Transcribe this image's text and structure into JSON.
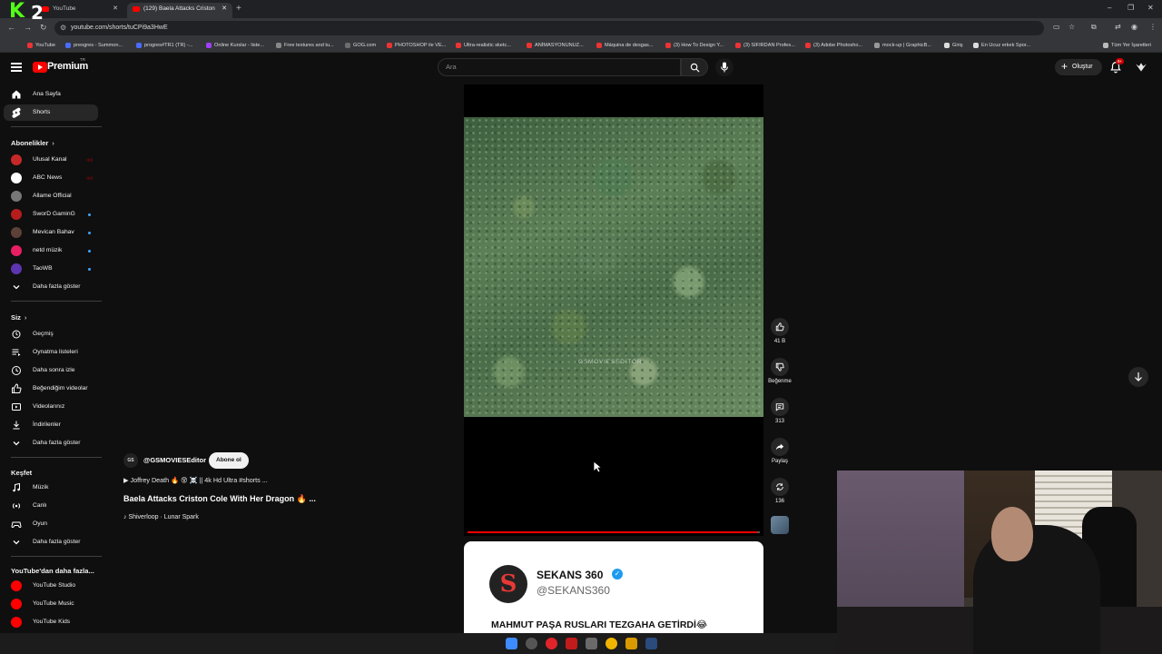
{
  "browser": {
    "tabs": [
      {
        "label": "YouTube"
      },
      {
        "label": "(129) Baela Attacks Criston"
      }
    ],
    "url": "youtube.com/shorts/tuCPi9a3HwE",
    "bookmarks": [
      "YouTube",
      "preogres - Summon...",
      "progres#TR1 (TR) -...",
      "Online Kurslar - liste...",
      "Free textures and tu...",
      "GOG.com",
      "PHOTOSHOP ile VE...",
      "Ultra-realistic sketc...",
      "ANİMASYONUNUZ...",
      "Máquina de desgas...",
      "(3) How To Design Y...",
      "(3) SIFIRDAN Profes...",
      "(3) Adobe Photosho...",
      "mock-up | GraphicB...",
      "Giriş",
      "En Ucuz erkek Spor..."
    ],
    "all_bookmarks": "Tüm Yer İşaretleri",
    "overlay_logo_letters": "K2"
  },
  "masthead": {
    "logo_text": "Premium",
    "region": "TR",
    "search_placeholder": "Ara",
    "create_label": "Oluştur",
    "notif_count": "9+"
  },
  "sidebar": {
    "main": [
      {
        "label": "Ana Sayfa",
        "icon": "home-icon"
      },
      {
        "label": "Shorts",
        "icon": "shorts-icon",
        "active": true
      }
    ],
    "subs_title": "Abonelikler",
    "subs": [
      {
        "label": "Ulusal Kanal",
        "color": "#c62828",
        "live": true
      },
      {
        "label": "ABC News",
        "color": "#ffffff",
        "live": true
      },
      {
        "label": "Allame Official",
        "color": "#777777"
      },
      {
        "label": "SworD GaminG",
        "color": "#b71c1c",
        "dot": true
      },
      {
        "label": "Mevican Bahav",
        "color": "#5d4037",
        "dot": true
      },
      {
        "label": "netd müzik",
        "color": "#e91e63",
        "dot": true
      },
      {
        "label": "TaoWB",
        "color": "#5e35b1",
        "dot": true
      }
    ],
    "subs_more": "Daha fazla göster",
    "you_title": "Siz",
    "you": [
      {
        "label": "Geçmiş",
        "icon": "history-icon"
      },
      {
        "label": "Oynatma listeleri",
        "icon": "playlist-icon"
      },
      {
        "label": "Daha sonra izle",
        "icon": "clock-icon"
      },
      {
        "label": "Beğendiğim videolar",
        "icon": "like-icon"
      },
      {
        "label": "Videolarınız",
        "icon": "video-icon"
      },
      {
        "label": "İndirilenler",
        "icon": "download-icon"
      }
    ],
    "you_more": "Daha fazla göster",
    "explore_title": "Keşfet",
    "explore": [
      {
        "label": "Müzik",
        "icon": "music-icon"
      },
      {
        "label": "Canlı",
        "icon": "live-icon"
      },
      {
        "label": "Oyun",
        "icon": "gaming-icon"
      }
    ],
    "explore_more": "Daha fazla göster",
    "more_title": "YouTube'dan daha fazla...",
    "more": [
      {
        "label": "YouTube Studio"
      },
      {
        "label": "YouTube Music"
      },
      {
        "label": "YouTube Kids"
      }
    ]
  },
  "short": {
    "channel_avatar": "GS",
    "channel": "@GSMOVIESEditor",
    "subscribe_label": "Abone ol",
    "description": "▶ Joffrey Death 🔥 😵 ☠️ || 4k Hd Ultra #shorts ...",
    "title": "Baela Attacks Criston Cole With Her Dragon 🔥 ...",
    "music": "♪ Shiverloop · Lunar Spark",
    "watermark": "GSMOVIESEDITOR",
    "progress": 0.99,
    "likes": "41 B",
    "dislike_label": "Beğenme",
    "comments": "313",
    "share_label": "Paylaş",
    "remix": "136"
  },
  "next_short": {
    "name": "SEKANS 360",
    "handle": "@SEKANS360",
    "headline": "MAHMUT PAŞA RUSLARI TEZGAHA GETİRDİ😂"
  }
}
